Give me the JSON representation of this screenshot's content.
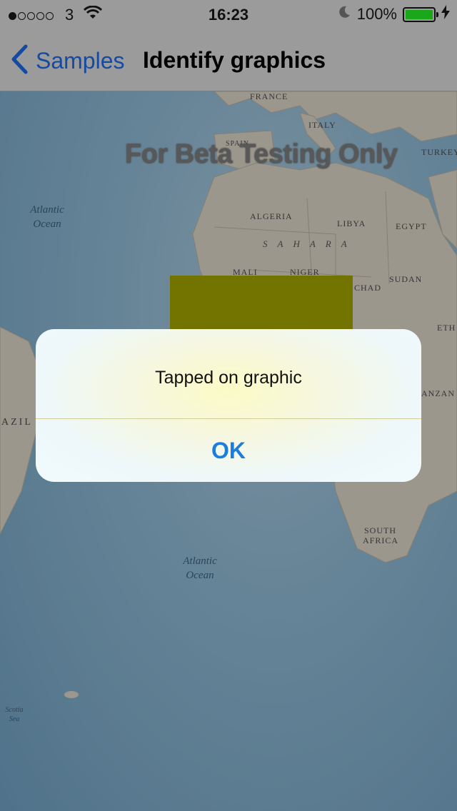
{
  "status_bar": {
    "carrier": "3",
    "time": "16:23",
    "battery": "100%",
    "battery_color": "#1aa81a",
    "icons": [
      "signal-dots-icon",
      "wifi-icon",
      "moon-icon",
      "battery-icon",
      "charging-bolt-icon"
    ]
  },
  "nav_bar": {
    "back_label": "Samples",
    "title": "Identify graphics"
  },
  "map": {
    "watermark": "For Beta Testing Only",
    "graphic_color": "#a0a000",
    "labels": {
      "france": "FRANCE",
      "spain": "SPAIN",
      "italy": "ITALY",
      "turkey": "TURKEY",
      "algeria": "ALGERIA",
      "libya": "LIBYA",
      "egypt": "EGYPT",
      "sahara": "SAHARA",
      "mali": "MALI",
      "niger": "NIGER",
      "chad": "CHAD",
      "sudan": "SUDAN",
      "ethiopia": "ETH",
      "brazil": "AZIL",
      "tanzania": "ANZAN",
      "south_africa_1": "SOUTH",
      "south_africa_2": "AFRICA",
      "atlantic_north_1": "Atlantic",
      "atlantic_north_2": "Ocean",
      "atlantic_south_1": "Atlantic",
      "atlantic_south_2": "Ocean",
      "scotia_1": "Scotia",
      "scotia_2": "Sea"
    }
  },
  "alert": {
    "message": "Tapped on graphic",
    "ok_label": "OK"
  }
}
